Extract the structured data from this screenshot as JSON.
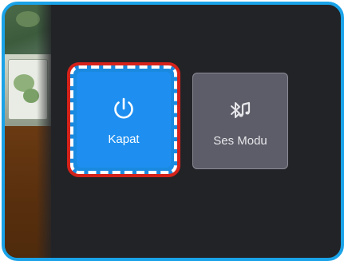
{
  "menu": {
    "items": [
      {
        "label": "Kapat",
        "icon": "power-icon",
        "selected": true
      },
      {
        "label": "Ses Modu",
        "icon": "bluetooth-music-icon",
        "selected": false
      }
    ]
  },
  "colors": {
    "frame_border": "#1aa3e8",
    "panel_background": "#222327",
    "selected_tile": "#1e8ff0",
    "unselected_tile": "#5c5d68",
    "focus_dash_red": "#d4221a",
    "focus_dash_white": "#ffffff"
  }
}
